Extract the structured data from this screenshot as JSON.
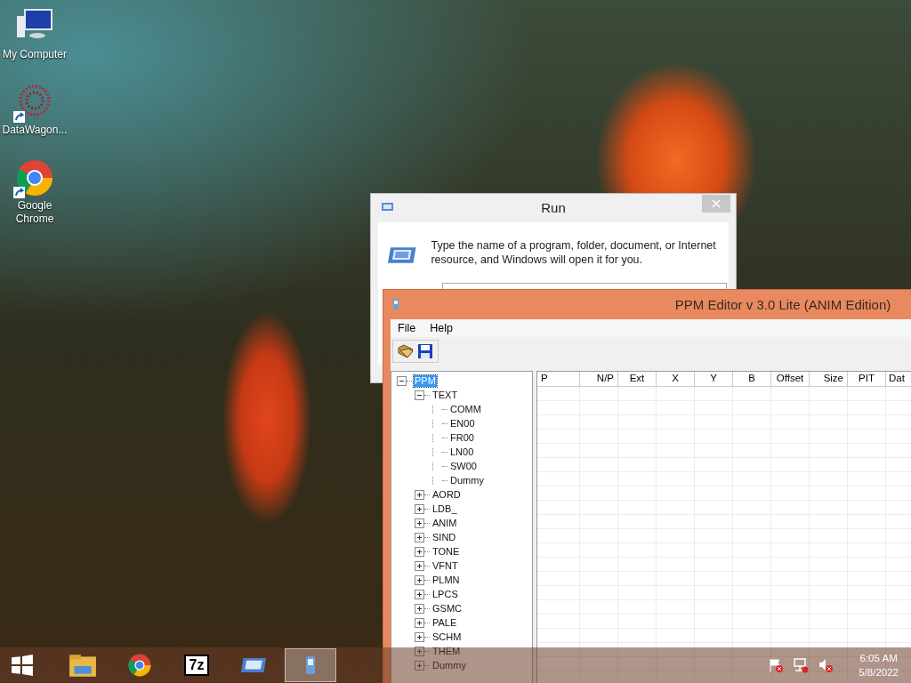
{
  "desktop_icons": [
    {
      "kind": "computer",
      "label": "My Computer",
      "shortcut": false
    },
    {
      "kind": "datawagon",
      "label": "DataWagon...",
      "shortcut": true
    },
    {
      "kind": "chrome",
      "label": "Google Chrome",
      "shortcut": true
    }
  ],
  "run_dialog": {
    "title": "Run",
    "description": "Type the name of a program, folder, document, or Internet resource, and Windows will open it for you."
  },
  "ppm_window": {
    "title": "PPM Editor v 3.0 Lite (ANIM Edition)",
    "menu": [
      "File",
      "Help"
    ],
    "tree": [
      {
        "label": "PPM",
        "expanded": true,
        "selected": true,
        "children": [
          {
            "label": "TEXT",
            "expanded": true,
            "selected": false,
            "children": [
              {
                "label": "COMM",
                "selected": false
              },
              {
                "label": "EN00",
                "selected": false
              },
              {
                "label": "FR00",
                "selected": false
              },
              {
                "label": "LN00",
                "selected": false
              },
              {
                "label": "SW00",
                "selected": false
              },
              {
                "label": "Dummy",
                "selected": false
              }
            ]
          },
          {
            "label": "AORD",
            "expanded": false,
            "selected": false
          },
          {
            "label": "LDB_",
            "expanded": false,
            "selected": false
          },
          {
            "label": "ANIM",
            "expanded": false,
            "selected": false
          },
          {
            "label": "SIND",
            "expanded": false,
            "selected": false
          },
          {
            "label": "TONE",
            "expanded": false,
            "selected": false
          },
          {
            "label": "VFNT",
            "expanded": false,
            "selected": false
          },
          {
            "label": "PLMN",
            "expanded": false,
            "selected": false
          },
          {
            "label": "LPCS",
            "expanded": false,
            "selected": false
          },
          {
            "label": "GSMC",
            "expanded": false,
            "selected": false
          },
          {
            "label": "PALE",
            "expanded": false,
            "selected": false
          },
          {
            "label": "SCHM",
            "expanded": false,
            "selected": false
          },
          {
            "label": "THEM",
            "expanded": false,
            "selected": false
          },
          {
            "label": "Dummy",
            "expanded": false,
            "selected": false
          }
        ]
      }
    ],
    "table": {
      "columns": [
        "P",
        "N/P",
        "Ext",
        "X",
        "Y",
        "B",
        "Offset",
        "Size",
        "PIT",
        "Dat"
      ]
    }
  },
  "taskbar": {
    "apps": [
      {
        "kind": "explorer",
        "active": false
      },
      {
        "kind": "chrome",
        "active": false
      },
      {
        "kind": "archiver",
        "label": "7z",
        "active": false
      },
      {
        "kind": "run",
        "active": false
      },
      {
        "kind": "ppm",
        "active": true
      }
    ],
    "time": "6:05 AM",
    "date": "5/8/2022"
  }
}
